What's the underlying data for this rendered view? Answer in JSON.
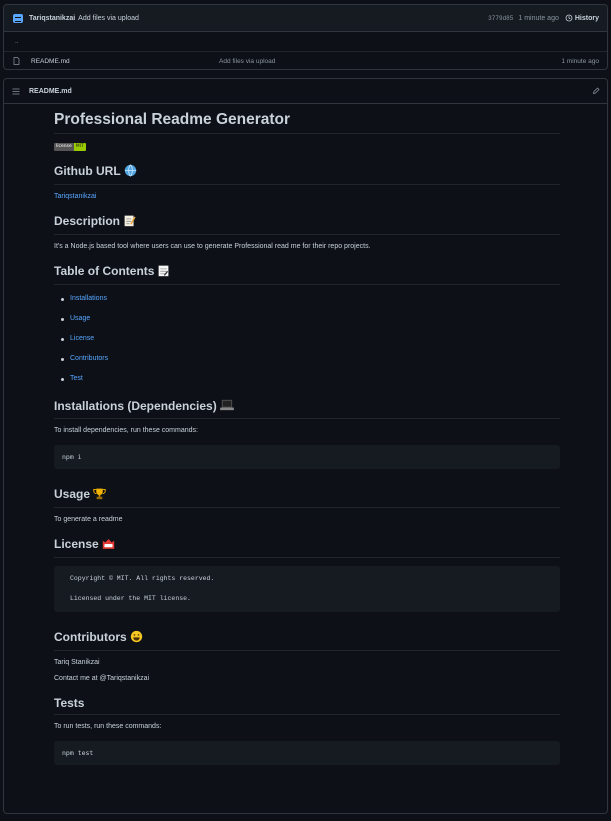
{
  "commit": {
    "author": "Tariqstanikzai",
    "message": "Add files via upload",
    "sha": "3779d85",
    "time": "1 minute ago",
    "history_label": "History"
  },
  "files": {
    "parent_link": "..",
    "rows": [
      {
        "name": "README.md",
        "message": "Add files via upload",
        "time": "1 minute ago"
      }
    ]
  },
  "readme": {
    "filename": "README.md",
    "title": "Professional Readme Generator",
    "badge": {
      "label": "license",
      "value": "MIT"
    },
    "github_heading": "Github URL",
    "github_link": "Tariqstanikzai",
    "description_heading": "Description",
    "description_text": "It's a Node.js based tool where users can use to generate Professional read me for their repo projects.",
    "toc_heading": "Table of Contents",
    "toc": [
      "Installations",
      "Usage",
      "License",
      "Contributors",
      "Test"
    ],
    "installations_heading": "Installations (Dependencies)",
    "installations_text": "To install dependencies, run these commands:",
    "installations_code": "npm i",
    "usage_heading": "Usage",
    "usage_text": "To generate a readme",
    "license_heading": "License",
    "license_lines": [
      "Copyright © MIT. All rights reserved.",
      "Licensed under the MIT license."
    ],
    "contributors_heading": "Contributors",
    "contributors_name": "Tariq Stanikzai",
    "contributors_contact": "Contact me at @Tariqstanikzai",
    "tests_heading": "Tests",
    "tests_text": "To run tests, run these commands:",
    "tests_code": "npm test"
  },
  "icons": {
    "avatar": "avatar-icon",
    "history": "history-icon",
    "file": "file-icon",
    "list": "list-icon",
    "edit": "pencil-icon",
    "globe": "globe-emoji",
    "memo": "memo-emoji",
    "notepad": "notepad-emoji",
    "laptop": "laptop-emoji",
    "trophy": "trophy-emoji",
    "badge": "name-badge-emoji",
    "smiley": "smiley-emoji"
  },
  "colors": {
    "link": "#58a6ff",
    "background": "#0d1117",
    "border": "#30363d",
    "badge_green": "#97ca00"
  }
}
